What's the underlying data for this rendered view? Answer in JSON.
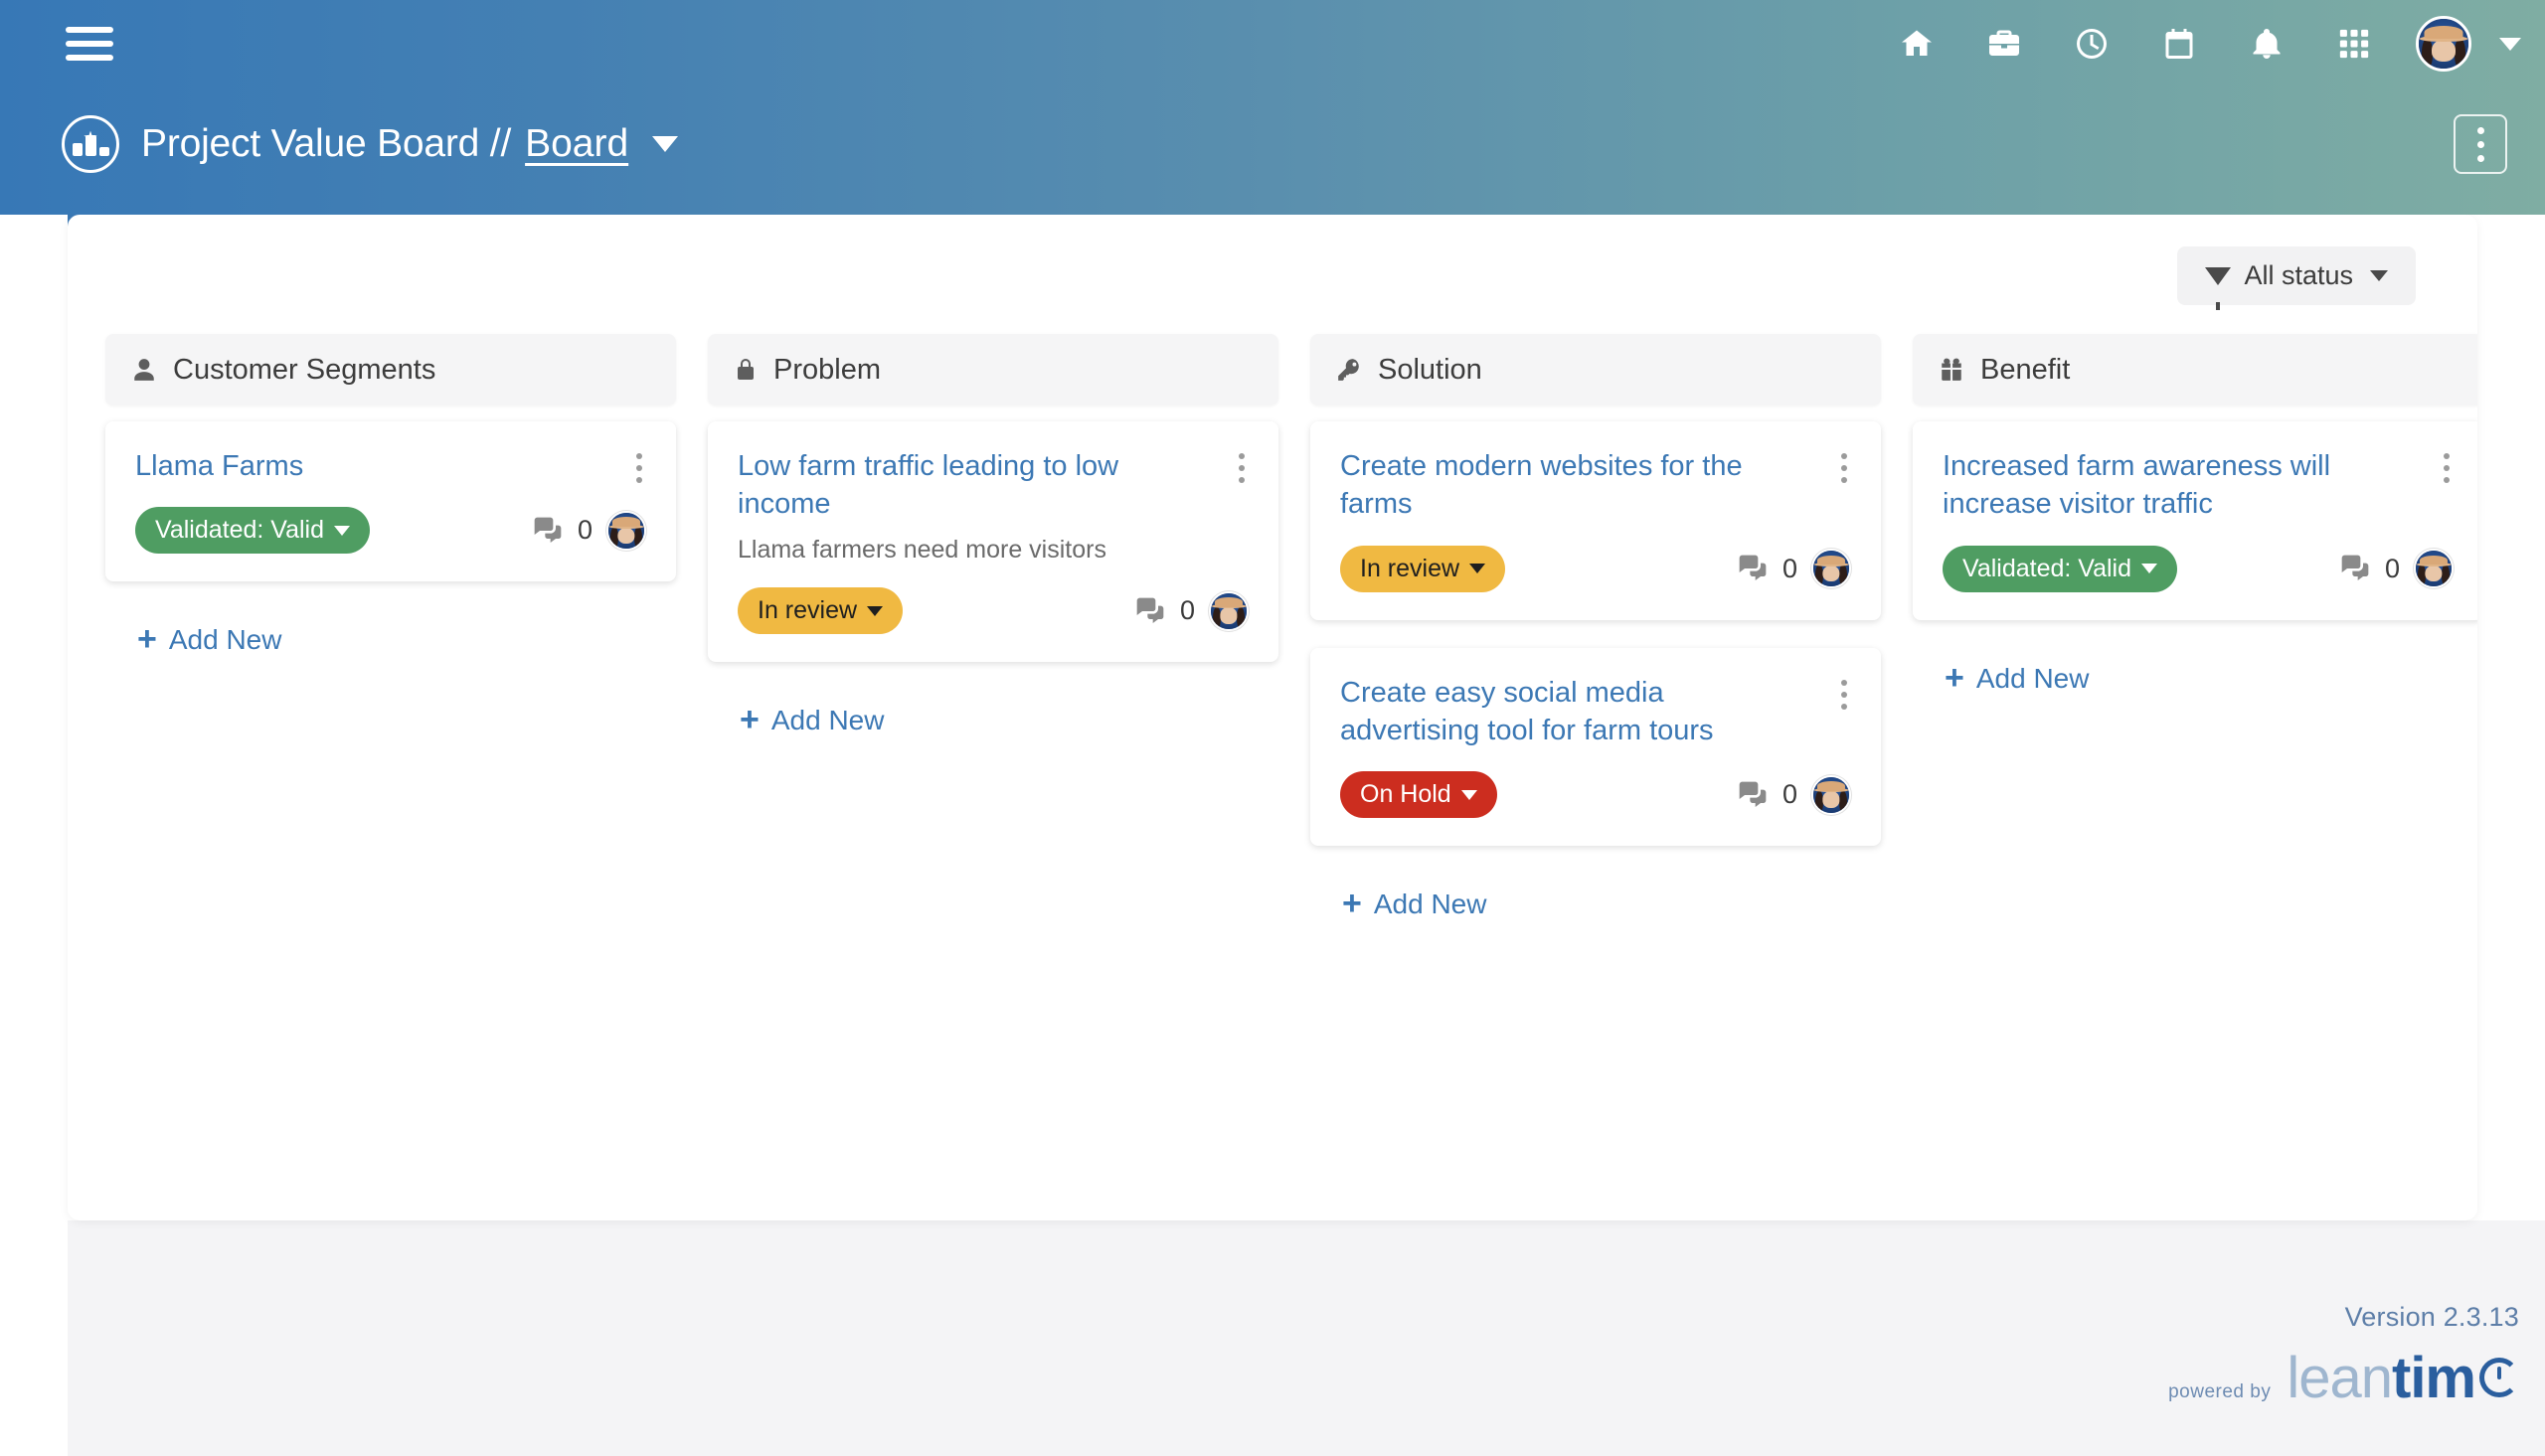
{
  "topbar": {
    "menu_label": "menu",
    "icons": [
      {
        "name": "home-icon",
        "label": "Home"
      },
      {
        "name": "briefcase-icon",
        "label": "Projects"
      },
      {
        "name": "clock-icon",
        "label": "Timesheets"
      },
      {
        "name": "calendar-icon",
        "label": "Calendar"
      },
      {
        "name": "bell-icon",
        "label": "Notifications"
      },
      {
        "name": "grid-apps-icon",
        "label": "Apps"
      }
    ],
    "user_caret": "▼"
  },
  "project_header": {
    "title": "Project Value Board //",
    "view_link": "Board",
    "view_caret": "▼",
    "options_label": "More options"
  },
  "toolbar": {
    "status_filter_label": "All status",
    "status_filter_caret": "▼"
  },
  "board": {
    "add_new_label": "Add New",
    "columns": [
      {
        "id": "customer-segments",
        "title": "Customer Segments",
        "icon": "user-icon",
        "cards": [
          {
            "title": "Llama Farms",
            "description": "",
            "status_label": "Validated: Valid",
            "status_color": "#4f9d62",
            "status_variant": "green",
            "comment_count": "0"
          }
        ]
      },
      {
        "id": "problem",
        "title": "Problem",
        "icon": "lock-icon",
        "cards": [
          {
            "title": "Low farm traffic leading to low income",
            "description": "Llama farmers need more visitors",
            "status_label": "In review",
            "status_color": "#f0b942",
            "status_variant": "amber",
            "comment_count": "0"
          }
        ]
      },
      {
        "id": "solution",
        "title": "Solution",
        "icon": "key-icon",
        "cards": [
          {
            "title": "Create modern websites for the farms",
            "description": "",
            "status_label": "In review",
            "status_color": "#f0b942",
            "status_variant": "amber",
            "comment_count": "0"
          },
          {
            "title": "Create easy social media advertising tool for farm tours",
            "description": "",
            "status_label": "On Hold",
            "status_color": "#cc2d1f",
            "status_variant": "red",
            "comment_count": "0"
          }
        ]
      },
      {
        "id": "benefit",
        "title": "Benefit",
        "icon": "gift-icon",
        "cards": [
          {
            "title": "Increased farm awareness will increase visitor traffic",
            "description": "",
            "status_label": "Validated: Valid",
            "status_color": "#4f9d62",
            "status_variant": "green",
            "comment_count": "0"
          }
        ]
      }
    ]
  },
  "footer": {
    "version": "Version 2.3.13",
    "powered_by": "powered by",
    "logo_lean": "lean",
    "logo_tim": "tim"
  },
  "colors": {
    "header_gradient_start": "#3778b6",
    "header_gradient_end": "#7fada3",
    "link_blue": "#3c78b4",
    "panel_bg": "#ffffff",
    "page_bg": "#f4f4f6",
    "column_header_bg": "#f5f5f6"
  }
}
